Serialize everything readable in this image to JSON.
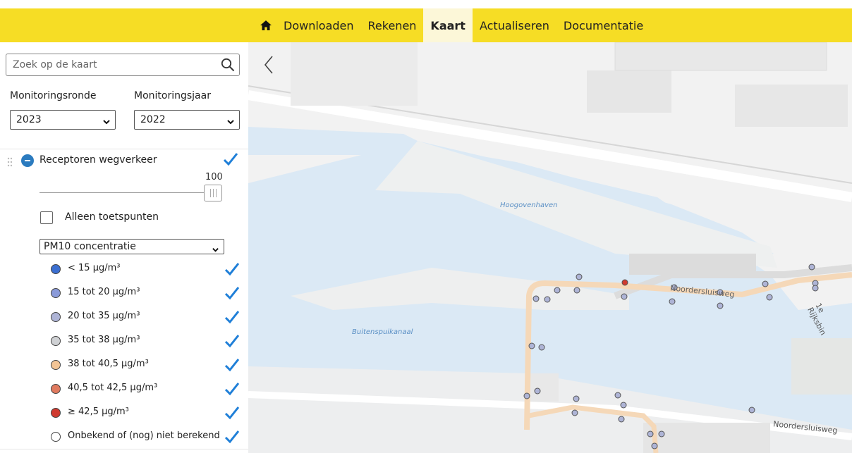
{
  "nav": {
    "items": [
      {
        "label": "Downloaden",
        "active": false
      },
      {
        "label": "Rekenen",
        "active": false
      },
      {
        "label": "Kaart",
        "active": true
      },
      {
        "label": "Actualiseren",
        "active": false
      },
      {
        "label": "Documentatie",
        "active": false
      }
    ]
  },
  "search": {
    "placeholder": "Zoek op de kaart"
  },
  "filters": {
    "ronde_label": "Monitoringsronde",
    "ronde_value": "2023",
    "jaar_label": "Monitoringsjaar",
    "jaar_value": "2022"
  },
  "layer": {
    "name": "Receptoren wegverkeer",
    "opacity": "100",
    "checkbox_label": "Alleen toetspunten",
    "substance": "PM10 concentratie"
  },
  "legend": [
    {
      "label": "< 15 µg/m³",
      "color": "#3b6fd1"
    },
    {
      "label": "15 tot 20 µg/m³",
      "color": "#8a9ad9"
    },
    {
      "label": "20 tot 35 µg/m³",
      "color": "#aeb4d6"
    },
    {
      "label": "35 tot 38 µg/m³",
      "color": "#cfd1d4"
    },
    {
      "label": "38 tot 40,5 µg/m³",
      "color": "#f3c596"
    },
    {
      "label": "40,5 tot 42,5 µg/m³",
      "color": "#e07a5f"
    },
    {
      "label": "≥ 42,5 µg/m³",
      "color": "#cf3a2f"
    },
    {
      "label": "Onbekend of (nog) niet berekend",
      "color": "#ffffff"
    }
  ],
  "map": {
    "labels": {
      "hoogovenhaven": "Hoogovenhaven",
      "buitenspuikanaal": "Buitenspuikanaal",
      "noordersluisweg": "Noordersluisweg",
      "noordersluisweg2": "Noordersluisweg",
      "rijksbin": "1e Rijksbin"
    }
  }
}
